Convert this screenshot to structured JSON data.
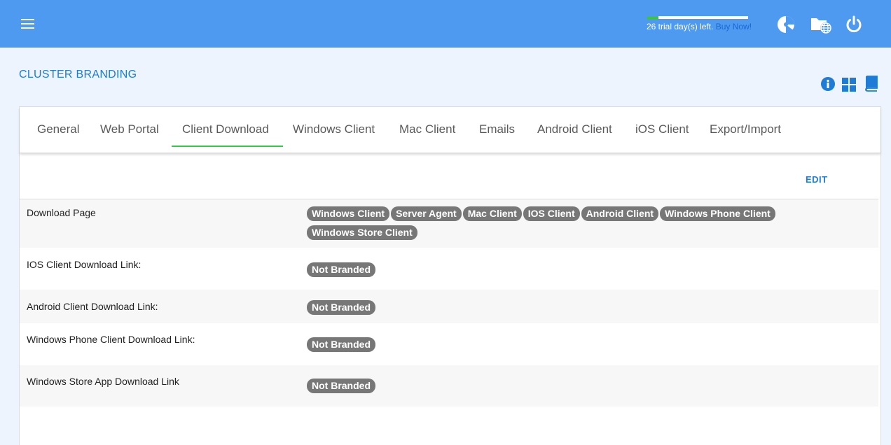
{
  "header": {
    "trial_progress": 0.12,
    "trial_text": "26 trial day(s) left.",
    "buy_now": "Buy Now!",
    "icons": [
      "menu-icon",
      "dashboard-icon",
      "file-manager-icon",
      "power-icon"
    ]
  },
  "page": {
    "title": "CLUSTER BRANDING",
    "side_icons": [
      "info-icon",
      "grid-icon",
      "book-icon"
    ]
  },
  "tabs": [
    {
      "label": "General"
    },
    {
      "label": "Web Portal"
    },
    {
      "label": "Client Download",
      "active": true
    },
    {
      "label": "Windows Client"
    },
    {
      "label": "Mac Client"
    },
    {
      "label": "Emails"
    },
    {
      "label": "Android Client"
    },
    {
      "label": "iOS Client"
    },
    {
      "label": "Export/Import"
    }
  ],
  "edit_label": "EDIT",
  "rows": [
    {
      "label": "Download Page",
      "badges": [
        "Windows Client",
        "Server Agent",
        "Mac Client",
        "IOS Client",
        "Android Client",
        "Windows Phone Client",
        "Windows Store Client"
      ]
    },
    {
      "label": "IOS Client Download Link:",
      "badges": [
        "Not Branded"
      ]
    },
    {
      "label": "Android Client Download Link:",
      "badges": [
        "Not Branded"
      ]
    },
    {
      "label": "Windows Phone Client Download Link:",
      "badges": [
        "Not Branded"
      ]
    },
    {
      "label": "Windows Store App Download Link",
      "badges": [
        "Not Branded"
      ]
    }
  ],
  "colors": {
    "header": "#4e9af1",
    "accent": "#1e7bd6",
    "active_tab": "#2ecc40",
    "badge": "#777777"
  }
}
